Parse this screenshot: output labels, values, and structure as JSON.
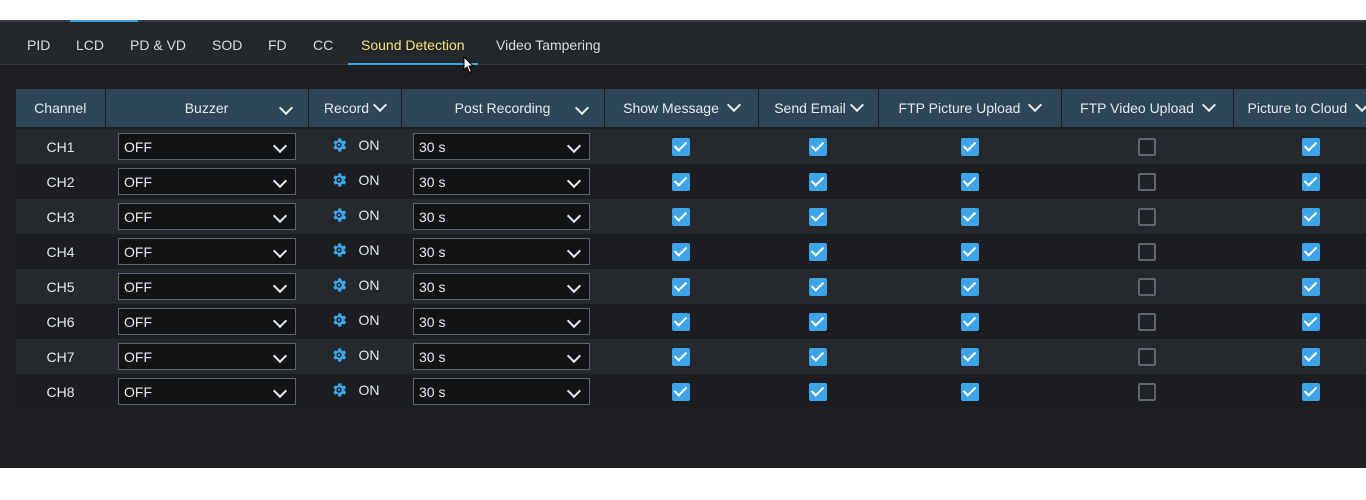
{
  "tabs": [
    "PID",
    "LCD",
    "PD & VD",
    "SOD",
    "FD",
    "CC",
    "Sound Detection",
    "Video Tampering"
  ],
  "active_tab": "Sound Detection",
  "table": {
    "headers": {
      "channel": "Channel",
      "buzzer": "Buzzer",
      "record": "Record",
      "post_recording": "Post Recording",
      "show_message": "Show Message",
      "send_email": "Send Email",
      "ftp_picture": "FTP Picture Upload",
      "ftp_video": "FTP Video Upload",
      "cloud": "Picture to Cloud"
    },
    "rows": [
      {
        "channel": "CH1",
        "buzzer": "OFF",
        "record": "ON",
        "post_recording": "30 s",
        "show_message": true,
        "send_email": true,
        "ftp_picture": true,
        "ftp_video": false,
        "cloud": true
      },
      {
        "channel": "CH2",
        "buzzer": "OFF",
        "record": "ON",
        "post_recording": "30 s",
        "show_message": true,
        "send_email": true,
        "ftp_picture": true,
        "ftp_video": false,
        "cloud": true
      },
      {
        "channel": "CH3",
        "buzzer": "OFF",
        "record": "ON",
        "post_recording": "30 s",
        "show_message": true,
        "send_email": true,
        "ftp_picture": true,
        "ftp_video": false,
        "cloud": true
      },
      {
        "channel": "CH4",
        "buzzer": "OFF",
        "record": "ON",
        "post_recording": "30 s",
        "show_message": true,
        "send_email": true,
        "ftp_picture": true,
        "ftp_video": false,
        "cloud": true
      },
      {
        "channel": "CH5",
        "buzzer": "OFF",
        "record": "ON",
        "post_recording": "30 s",
        "show_message": true,
        "send_email": true,
        "ftp_picture": true,
        "ftp_video": false,
        "cloud": true
      },
      {
        "channel": "CH6",
        "buzzer": "OFF",
        "record": "ON",
        "post_recording": "30 s",
        "show_message": true,
        "send_email": true,
        "ftp_picture": true,
        "ftp_video": false,
        "cloud": true
      },
      {
        "channel": "CH7",
        "buzzer": "OFF",
        "record": "ON",
        "post_recording": "30 s",
        "show_message": true,
        "send_email": true,
        "ftp_picture": true,
        "ftp_video": false,
        "cloud": true
      },
      {
        "channel": "CH8",
        "buzzer": "OFF",
        "record": "ON",
        "post_recording": "30 s",
        "show_message": true,
        "send_email": true,
        "ftp_picture": true,
        "ftp_video": false,
        "cloud": true
      }
    ]
  },
  "icons": {
    "record_settings": "gear-icon",
    "dropdown": "chevron-down-icon",
    "pointer": "mouse-cursor-icon"
  },
  "colors": {
    "accent": "#3ea4e8",
    "active_tab_text": "#f1e27a",
    "header_bg": "#2d4658",
    "background": "#1c1e22"
  }
}
